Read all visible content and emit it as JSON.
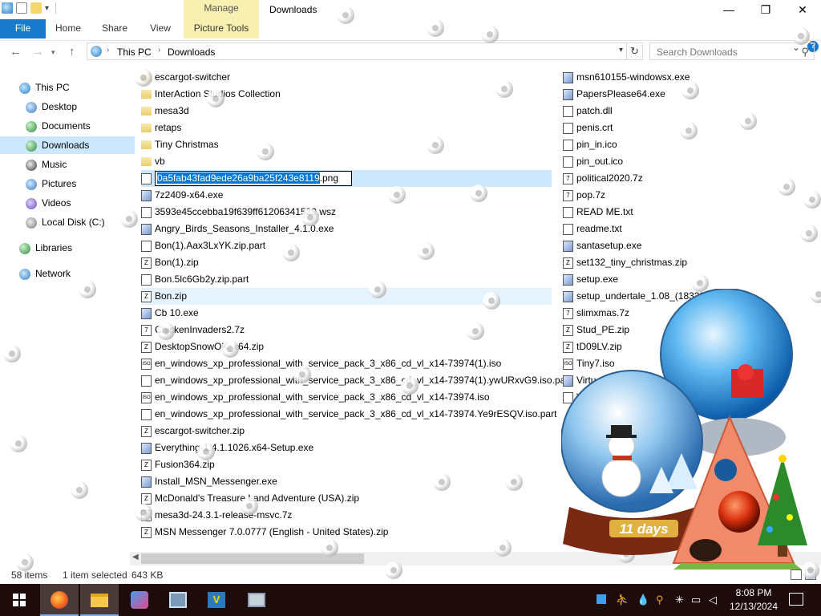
{
  "window": {
    "title": "Downloads",
    "contextual_tab_group": "Manage"
  },
  "ribbon": {
    "tabs": [
      "File",
      "Home",
      "Share",
      "View",
      "Picture Tools"
    ],
    "expand_glyph": "⌄",
    "help_glyph": "?"
  },
  "address": {
    "crumbs": [
      "This PC",
      "Downloads"
    ],
    "search_placeholder": "Search Downloads"
  },
  "nav": {
    "items": [
      {
        "label": "This PC",
        "icon": "computer-icon"
      },
      {
        "label": "Desktop",
        "icon": "desktop-icon"
      },
      {
        "label": "Documents",
        "icon": "documents-icon"
      },
      {
        "label": "Downloads",
        "icon": "downloads-icon"
      },
      {
        "label": "Music",
        "icon": "music-icon"
      },
      {
        "label": "Pictures",
        "icon": "pictures-icon"
      },
      {
        "label": "Videos",
        "icon": "videos-icon"
      },
      {
        "label": "Local Disk (C:)",
        "icon": "drive-icon"
      },
      {
        "label": "Libraries",
        "icon": "libraries-icon"
      },
      {
        "label": "Network",
        "icon": "network-icon"
      }
    ]
  },
  "files": {
    "col1": [
      {
        "name": "escargot-switcher",
        "type": "folder"
      },
      {
        "name": "InterAction Studios Collection",
        "type": "folder"
      },
      {
        "name": "mesa3d",
        "type": "folder"
      },
      {
        "name": "retaps",
        "type": "folder"
      },
      {
        "name": "Tiny Christmas",
        "type": "folder"
      },
      {
        "name": "vb",
        "type": "folder"
      },
      {
        "name": "",
        "type": "rename"
      },
      {
        "name": "7z2409-x64.exe",
        "type": "exe"
      },
      {
        "name": "3593e45ccebba19f639ff61206341529.wsz",
        "type": "file"
      },
      {
        "name": "Angry_Birds_Seasons_Installer_4.1.0.exe",
        "type": "exe"
      },
      {
        "name": "Bon(1).Aax3LxYK.zip.part",
        "type": "file"
      },
      {
        "name": "Bon(1).zip",
        "type": "zip"
      },
      {
        "name": "Bon.5lc6Gb2y.zip.part",
        "type": "file"
      },
      {
        "name": "Bon.zip",
        "type": "zip"
      },
      {
        "name": "Cb  10.exe",
        "type": "exe"
      },
      {
        "name": "ChickenInvaders2.7z",
        "type": "7z"
      },
      {
        "name": "DesktopSnowOK_x64.zip",
        "type": "zip"
      },
      {
        "name": "en_windows_xp_professional_with_service_pack_3_x86_cd_vl_x14-73974(1).iso",
        "type": "iso"
      },
      {
        "name": "en_windows_xp_professional_with_service_pack_3_x86_cd_vl_x14-73974(1).ywURxvG9.iso.part",
        "type": "file"
      },
      {
        "name": "en_windows_xp_professional_with_service_pack_3_x86_cd_vl_x14-73974.iso",
        "type": "iso"
      },
      {
        "name": "en_windows_xp_professional_with_service_pack_3_x86_cd_vl_x14-73974.Ye9rESQV.iso.part",
        "type": "file"
      },
      {
        "name": "escargot-switcher.zip",
        "type": "zip"
      },
      {
        "name": "Everything-1.4.1.1026.x64-Setup.exe",
        "type": "exe"
      },
      {
        "name": "Fusion364.zip",
        "type": "zip"
      },
      {
        "name": "Install_MSN_Messenger.exe",
        "type": "exe"
      },
      {
        "name": "McDonald's Treasure Land Adventure (USA).zip",
        "type": "zip"
      },
      {
        "name": "mesa3d-24.3.1-release-msvc.7z",
        "type": "7z"
      },
      {
        "name": "MSN Messenger 7.0.0777 (English - United States).zip",
        "type": "zip"
      }
    ],
    "col2": [
      {
        "name": "msn610155-windowsx.exe",
        "type": "exe"
      },
      {
        "name": "PapersPlease64.exe",
        "type": "exe"
      },
      {
        "name": "patch.dll",
        "type": "file"
      },
      {
        "name": "penis.crt",
        "type": "file"
      },
      {
        "name": "pin_in.ico",
        "type": "file"
      },
      {
        "name": "pin_out.ico",
        "type": "file"
      },
      {
        "name": "political2020.7z",
        "type": "7z"
      },
      {
        "name": "pop.7z",
        "type": "7z"
      },
      {
        "name": "READ ME.txt",
        "type": "file"
      },
      {
        "name": "readme.txt",
        "type": "file"
      },
      {
        "name": "santasetup.exe",
        "type": "exe"
      },
      {
        "name": "set132_tiny_christmas.zip",
        "type": "zip"
      },
      {
        "name": "setup.exe",
        "type": "exe"
      },
      {
        "name": "setup_undertale_1.08_(18328)",
        "type": "exe"
      },
      {
        "name": "slimxmas.7z",
        "type": "7z"
      },
      {
        "name": "Stud_PE.zip",
        "type": "zip"
      },
      {
        "name": "tD09LV.zip",
        "type": "zip"
      },
      {
        "name": "Tiny7.iso",
        "type": "iso"
      },
      {
        "name": "Virtu",
        "type": "exe"
      },
      {
        "name": "V",
        "type": "file"
      }
    ],
    "rename": {
      "selected_part": "0a5fab43fad9ede26a9ba25f243e8119",
      "extension": ".png"
    }
  },
  "status": {
    "count": "58 items",
    "selection": "1 item selected",
    "size": "643 KB"
  },
  "taskbar": {
    "apps": [
      "start-icon",
      "firefox-icon",
      "file-explorer-icon",
      "app-icon",
      "app-icon-2",
      "visual-studio-icon",
      "app-icon-3"
    ],
    "time": "8:08 PM",
    "date": "12/13/2024"
  },
  "decoration": {
    "days_label": "11 days"
  }
}
